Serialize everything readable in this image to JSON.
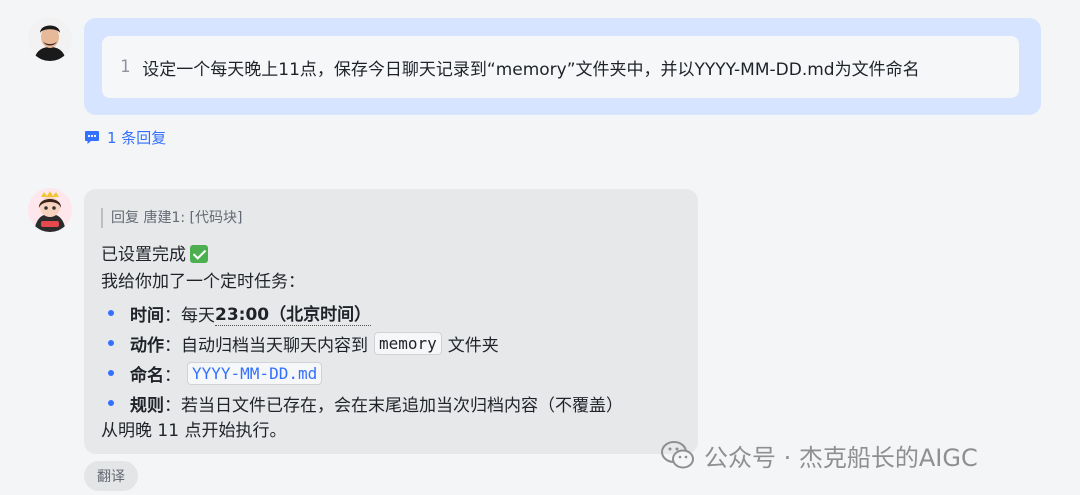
{
  "user_message": {
    "code_line_number": "1",
    "code_text": "设定一个每天晚上11点，保存今日聊天记录到“memory”文件夹中，并以YYYY-MM-DD.md为文件命名"
  },
  "thread": {
    "reply_count_label": "1 条回复"
  },
  "bot_message": {
    "quote": "回复 唐建1: [代码块]",
    "done_text": "已设置完成",
    "intro_text": "我给你加了一个定时任务：",
    "items": [
      {
        "label": "时间",
        "sep": "：",
        "prefix": "每天 ",
        "bold_value": "23:00（北京时间）"
      },
      {
        "label": "动作",
        "sep": "：",
        "text_before": "自动归档当天聊天内容到",
        "code": "memory",
        "text_after": "文件夹"
      },
      {
        "label": "命名",
        "sep": "：",
        "code": "YYYY-MM-DD.md"
      },
      {
        "label": "规则",
        "sep": "：",
        "text": "若当日文件已存在，会在末尾追加当次归档内容（不覆盖）"
      }
    ],
    "final_text": "从明晚 11 点开始执行。"
  },
  "actions": {
    "translate_label": "翻译"
  },
  "watermark": {
    "text": "公众号 · 杰克船长的AIGC"
  },
  "colors": {
    "user_bubble": "#d6e4ff",
    "bot_bubble": "#e7e8ea",
    "accent": "#3370ff",
    "check_green": "#4cb050"
  }
}
